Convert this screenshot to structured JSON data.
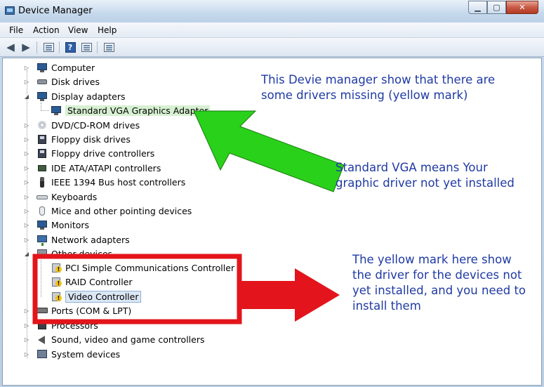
{
  "window": {
    "title": "Device Manager"
  },
  "menu": [
    "File",
    "Action",
    "View",
    "Help"
  ],
  "toolbar": {
    "back_icon": "back-arrow-icon",
    "forward_icon": "forward-arrow-icon",
    "help_glyph": "?"
  },
  "tree": {
    "items": [
      {
        "label": "Computer",
        "icon": "computer-icon"
      },
      {
        "label": "Disk drives",
        "icon": "disk-drive-icon"
      },
      {
        "label": "Display adapters",
        "icon": "display-adapter-icon",
        "expanded": true
      },
      {
        "label": "Standard VGA Graphics Adapter",
        "icon": "monitor-icon",
        "child": true
      },
      {
        "label": "DVD/CD-ROM drives",
        "icon": "dvd-icon"
      },
      {
        "label": "Floppy disk drives",
        "icon": "floppy-icon"
      },
      {
        "label": "Floppy drive controllers",
        "icon": "floppy-controller-icon"
      },
      {
        "label": "IDE ATA/ATAPI controllers",
        "icon": "ide-controller-icon"
      },
      {
        "label": "IEEE 1394 Bus host controllers",
        "icon": "ieee1394-icon"
      },
      {
        "label": "Keyboards",
        "icon": "keyboard-icon"
      },
      {
        "label": "Mice and other pointing devices",
        "icon": "mouse-icon"
      },
      {
        "label": "Monitors",
        "icon": "monitor-icon"
      },
      {
        "label": "Network adapters",
        "icon": "network-adapter-icon"
      },
      {
        "label": "Other devices",
        "icon": "other-devices-icon",
        "expanded": true
      },
      {
        "label": "PCI Simple Communications Controller",
        "icon": "warning-device-icon",
        "child": true
      },
      {
        "label": "RAID Controller",
        "icon": "warning-device-icon",
        "child": true
      },
      {
        "label": "Video Controller",
        "icon": "warning-device-icon",
        "child": true
      },
      {
        "label": "Ports (COM & LPT)",
        "icon": "port-icon"
      },
      {
        "label": "Processors",
        "icon": "processor-icon"
      },
      {
        "label": "Sound, video and game controllers",
        "icon": "speaker-icon"
      },
      {
        "label": "System devices",
        "icon": "system-devices-icon"
      }
    ]
  },
  "annotations": {
    "note1": [
      "This Devie manager show that there are",
      "some drivers missing (yellow mark)"
    ],
    "note2": [
      "Standard VGA means Your",
      "graphic driver not yet installed"
    ],
    "note3": [
      "The yellow mark here show",
      "the driver for the devices not",
      "yet installed, and you need to",
      "install them"
    ]
  },
  "colors": {
    "annotation_text": "#1f3aa3",
    "green_arrow": "#2ad11a",
    "red_box": "#e3141b"
  }
}
